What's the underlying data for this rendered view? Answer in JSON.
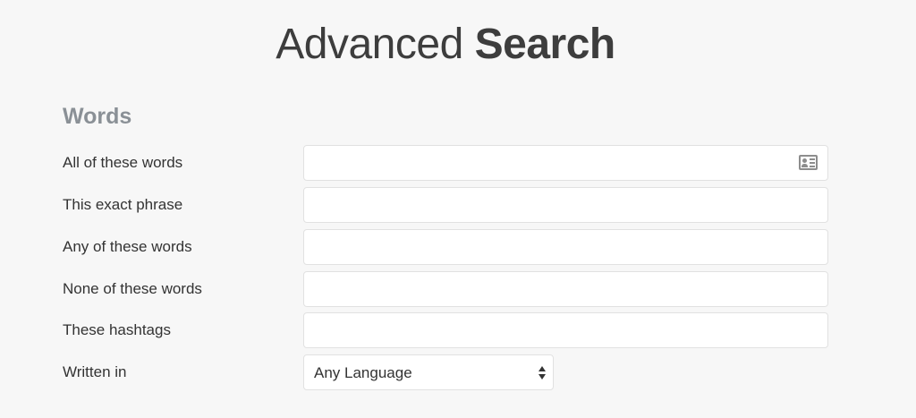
{
  "header": {
    "title_light": "Advanced",
    "title_bold": "Search"
  },
  "words_section": {
    "title": "Words",
    "fields": [
      {
        "label": "All of these words",
        "value": "",
        "icon": "contact-card-icon"
      },
      {
        "label": "This exact phrase",
        "value": ""
      },
      {
        "label": "Any of these words",
        "value": ""
      },
      {
        "label": "None of these words",
        "value": ""
      },
      {
        "label": "These hashtags",
        "value": ""
      }
    ],
    "language": {
      "label": "Written in",
      "selected": "Any Language"
    }
  }
}
